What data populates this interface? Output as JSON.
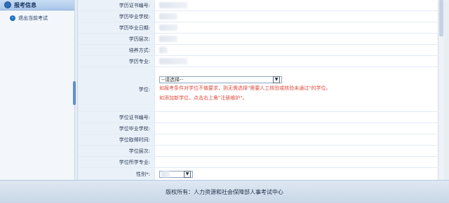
{
  "sidebar": {
    "header": "报考信息",
    "items": [
      {
        "label": "退出当前考试"
      }
    ]
  },
  "form": {
    "fields": [
      {
        "label": "学历证书编号:"
      },
      {
        "label": "学历毕业学校:"
      },
      {
        "label": "学历毕业日期:"
      },
      {
        "label": "学历层次:"
      },
      {
        "label": "培养方式:"
      },
      {
        "label": "学历专业:"
      }
    ],
    "degree": {
      "label": "学位:",
      "select_value": "--请选择--",
      "note1": "如报考条件对学位不做要求，则无需选择\"需要人工核验或核验未通过\"的学位。",
      "note2": "如添加新学位，点击右上角\"注册维护\"。"
    },
    "degree_fields": [
      {
        "label": "学位证书编号:"
      },
      {
        "label": "学位毕业学校:"
      },
      {
        "label": "学位取得时间:"
      },
      {
        "label": "学位层次:"
      },
      {
        "label": "学位所学专业:"
      }
    ],
    "gender": {
      "label": "性别*:"
    }
  },
  "footer": {
    "text": "版权所有：人力资源和社会保障部人事考试中心"
  }
}
